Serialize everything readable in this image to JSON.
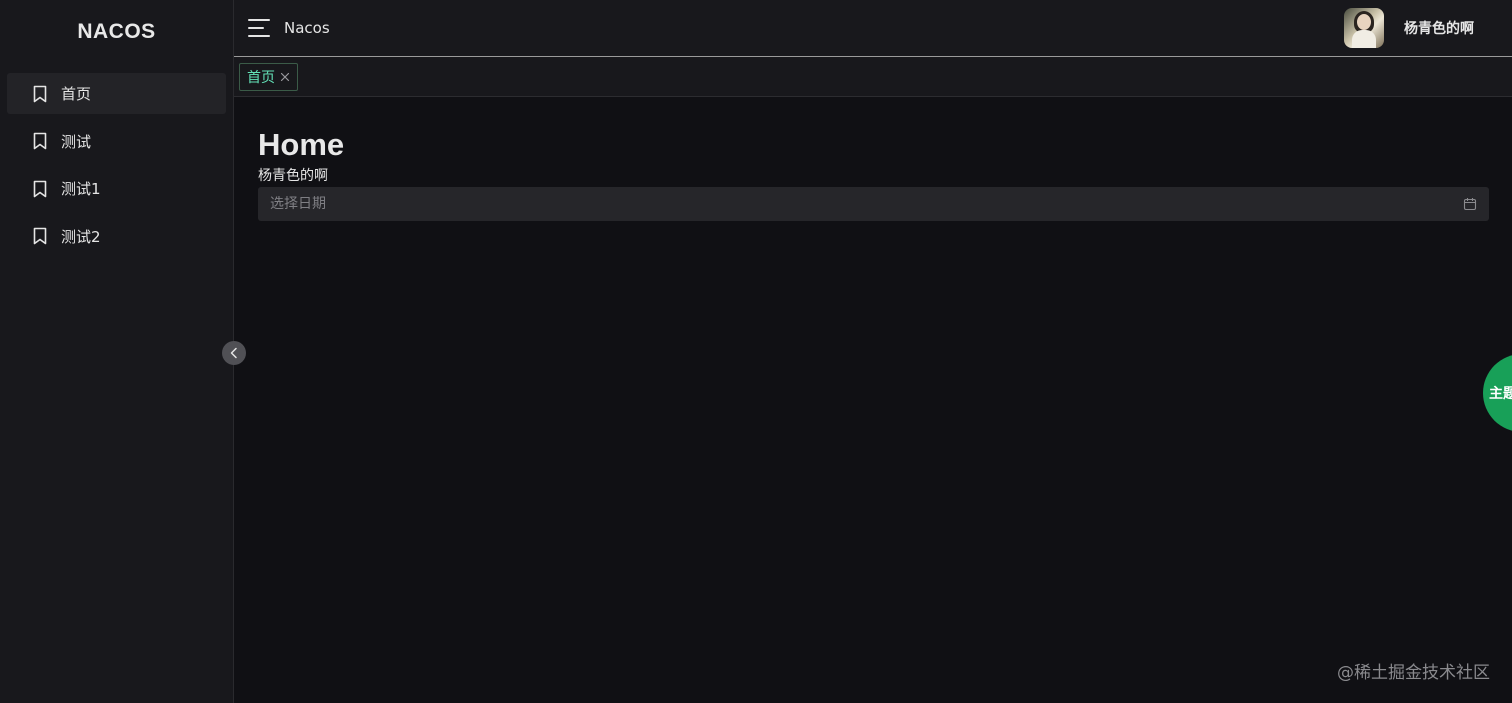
{
  "app": {
    "logo": "NACOS"
  },
  "header": {
    "title": "Nacos",
    "username": "杨青色的啊"
  },
  "sidebar": {
    "items": [
      {
        "label": "首页",
        "icon": "bookmark-icon",
        "active": true
      },
      {
        "label": "测试",
        "icon": "bookmark-icon",
        "active": false
      },
      {
        "label": "测试1",
        "icon": "bookmark-icon",
        "active": false
      },
      {
        "label": "测试2",
        "icon": "bookmark-icon",
        "active": false
      }
    ]
  },
  "tabs": [
    {
      "label": "首页"
    }
  ],
  "main": {
    "title": "Home",
    "subtitle": "杨青色的啊",
    "date_picker": {
      "placeholder": "选择日期",
      "value": ""
    }
  },
  "theme_button": {
    "label": "主题"
  },
  "watermark": "@稀土掘金技术社区",
  "colors": {
    "accent": "#63e2b7",
    "theme_button": "#18a058",
    "background": "#101014",
    "sidebar": "#18181c"
  }
}
